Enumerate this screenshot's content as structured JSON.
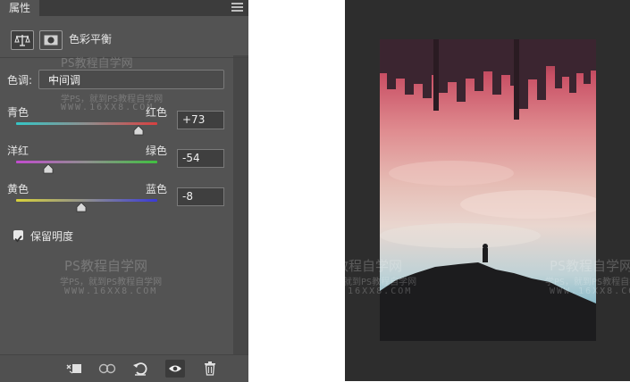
{
  "panel": {
    "tab_title": "属性",
    "adjustment_title": "色彩平衡",
    "tone": {
      "label": "色调:",
      "value": "中间调"
    },
    "sliders": [
      {
        "left": "青色",
        "right": "红色",
        "value": "+73",
        "level": 73
      },
      {
        "left": "洋红",
        "right": "绿色",
        "value": "-54",
        "level": -54
      },
      {
        "left": "黄色",
        "right": "蓝色",
        "value": "-8",
        "level": -8
      }
    ],
    "preserve_luminosity": {
      "label": "保留明度",
      "checked": true
    },
    "footer_buttons": [
      "clip-to-layer-icon",
      "view-previous-icon",
      "reset-icon",
      "visibility-icon",
      "delete-icon"
    ]
  },
  "watermark": {
    "title": "PS教程自学网",
    "subtitle": "学PS，就到PS教程自学网",
    "url": "WWW.16XX8.COM"
  },
  "colors": {
    "panel_bg": "#535353",
    "canvas_bg": "#2d2d2d",
    "accent_red": "#d84040"
  }
}
